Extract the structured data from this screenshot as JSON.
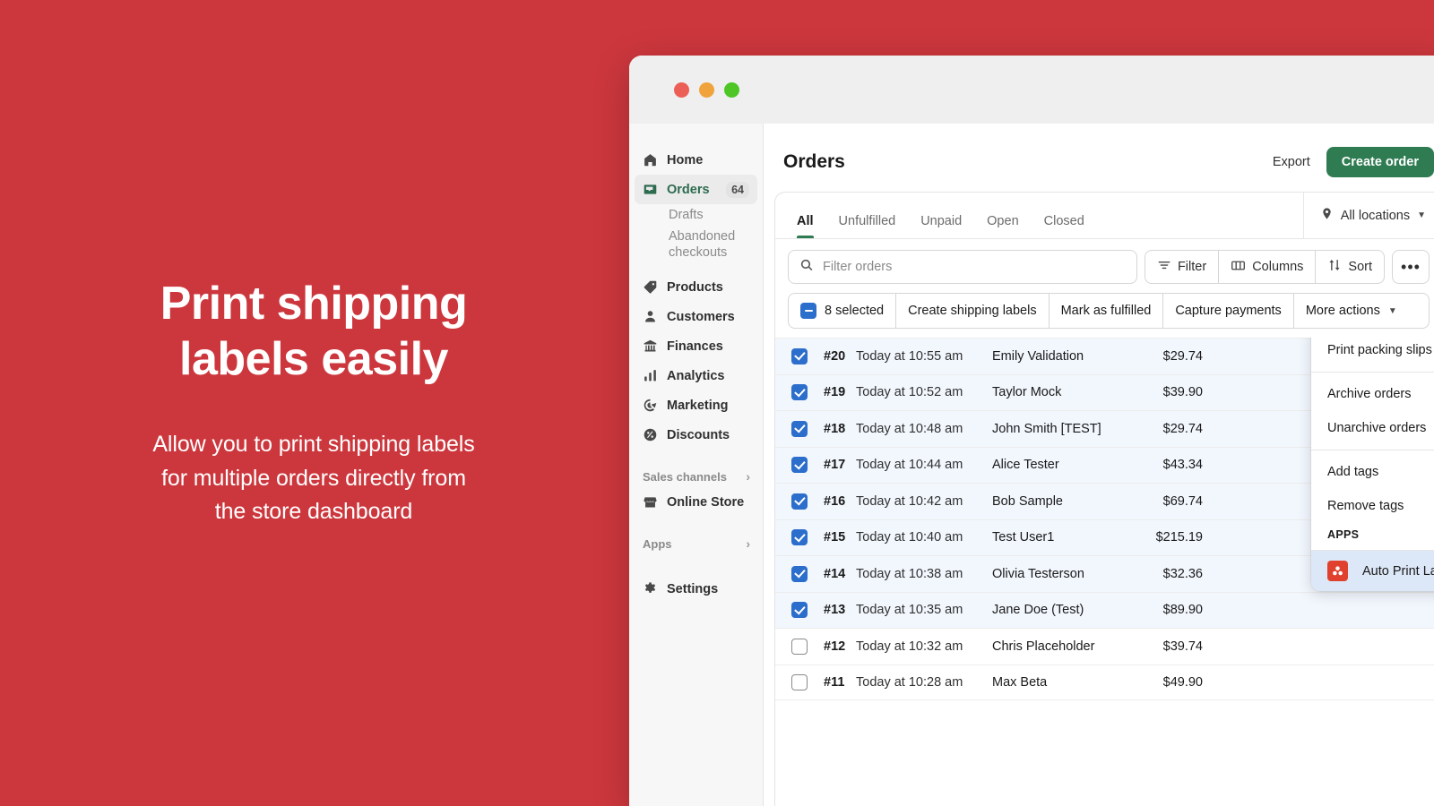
{
  "hero": {
    "title_line1": "Print shipping",
    "title_line2": "labels easily",
    "sub_line1": "Allow you to print shipping labels",
    "sub_line2": "for multiple orders directly from",
    "sub_line3": "the store dashboard",
    "background_color": "#cc373d"
  },
  "window": {
    "traffic_lights": [
      "close-red",
      "minimize-yellow",
      "maximize-green"
    ]
  },
  "sidebar": {
    "items": [
      {
        "label": "Home",
        "icon": "home-icon"
      },
      {
        "label": "Orders",
        "icon": "orders-icon",
        "badge": "64",
        "active": true
      },
      {
        "label": "Products",
        "icon": "tag-icon"
      },
      {
        "label": "Customers",
        "icon": "person-icon"
      },
      {
        "label": "Finances",
        "icon": "bank-icon"
      },
      {
        "label": "Analytics",
        "icon": "bar-chart-icon"
      },
      {
        "label": "Marketing",
        "icon": "marketing-icon"
      },
      {
        "label": "Discounts",
        "icon": "discount-icon"
      }
    ],
    "subitems": [
      "Drafts",
      "Abandoned checkouts"
    ],
    "sales_channels_label": "Sales channels",
    "online_store_label": "Online Store",
    "apps_label": "Apps",
    "settings_label": "Settings",
    "accent_color": "#2d6b4f"
  },
  "header": {
    "title": "Orders",
    "export_label": "Export",
    "create_order_label": "Create order",
    "primary_color": "#2f7c52"
  },
  "tabs": [
    {
      "label": "All",
      "active": true
    },
    {
      "label": "Unfulfilled",
      "active": false
    },
    {
      "label": "Unpaid",
      "active": false
    },
    {
      "label": "Open",
      "active": false
    },
    {
      "label": "Closed",
      "active": false
    }
  ],
  "locations": {
    "label": "All locations"
  },
  "toolbar": {
    "search_placeholder": "Filter orders",
    "search_value": "",
    "filter_label": "Filter",
    "columns_label": "Columns",
    "sort_label": "Sort",
    "more_label": "•••"
  },
  "bulkbar": {
    "selected_label": "8 selected",
    "create_shipping_labels_label": "Create shipping labels",
    "mark_as_fulfilled_label": "Mark as fulfilled",
    "capture_payments_label": "Capture payments",
    "more_actions_label": "More actions"
  },
  "orders": [
    {
      "checked": true,
      "number": "#20",
      "date": "Today at 10:55 am",
      "customer": "Emily Validation",
      "amount": "$29.74"
    },
    {
      "checked": true,
      "number": "#19",
      "date": "Today at 10:52 am",
      "customer": "Taylor Mock",
      "amount": "$39.90"
    },
    {
      "checked": true,
      "number": "#18",
      "date": "Today at 10:48 am",
      "customer": "John Smith [TEST]",
      "amount": "$29.74"
    },
    {
      "checked": true,
      "number": "#17",
      "date": "Today at 10:44 am",
      "customer": "Alice Tester",
      "amount": "$43.34"
    },
    {
      "checked": true,
      "number": "#16",
      "date": "Today at 10:42 am",
      "customer": "Bob Sample",
      "amount": "$69.74"
    },
    {
      "checked": true,
      "number": "#15",
      "date": "Today at 10:40 am",
      "customer": "Test User1",
      "amount": "$215.19"
    },
    {
      "checked": true,
      "number": "#14",
      "date": "Today at 10:38 am",
      "customer": "Olivia Testerson",
      "amount": "$32.36"
    },
    {
      "checked": true,
      "number": "#13",
      "date": "Today at 10:35 am",
      "customer": "Jane Doe (Test)",
      "amount": "$89.90"
    },
    {
      "checked": false,
      "number": "#12",
      "date": "Today at 10:32 am",
      "customer": "Chris Placeholder",
      "amount": "$39.74"
    },
    {
      "checked": false,
      "number": "#11",
      "date": "Today at 10:28 am",
      "customer": "Max Beta",
      "amount": "$49.90"
    }
  ],
  "menu": {
    "items_group1": [
      "Print packing slips"
    ],
    "items_group2": [
      "Archive orders",
      "Unarchive orders"
    ],
    "items_group3": [
      "Add tags",
      "Remove tags"
    ],
    "apps_header": "APPS",
    "app_item": {
      "label": "Auto Print Labels",
      "icon": "auto-print-labels-app-icon",
      "highlight_color": "#dce7f7"
    }
  }
}
